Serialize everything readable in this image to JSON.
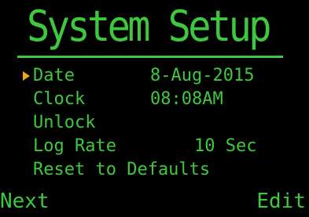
{
  "screen": {
    "title": "System Setup"
  },
  "colors": {
    "background": "#000000",
    "text": "#3ec83e",
    "cursor": "#f0a818"
  },
  "menu": {
    "selected_index": 0,
    "items": [
      {
        "label": "Date",
        "value": "8-Aug-2015"
      },
      {
        "label": "Clock",
        "value": "08:08AM"
      },
      {
        "label": "Unlock",
        "value": ""
      },
      {
        "label": "Log Rate",
        "value": "10 Sec"
      },
      {
        "label": "Reset to Defaults",
        "value": ""
      }
    ]
  },
  "softkeys": {
    "left": "Next",
    "right": "Edit"
  },
  "icons": {
    "cursor": "selection-arrow-icon"
  }
}
